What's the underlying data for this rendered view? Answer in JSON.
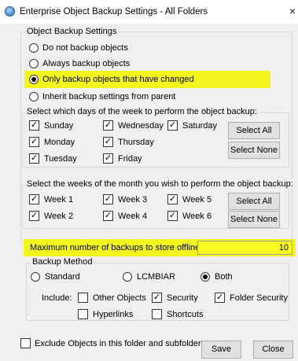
{
  "window": {
    "title": "Enterprise Object Backup Settings - All Folders",
    "close_glyph": "×"
  },
  "object_backup": {
    "group_label": "Object Backup Settings",
    "options": [
      {
        "label": "Do not backup objects",
        "checked": false
      },
      {
        "label": "Always backup objects",
        "checked": false
      },
      {
        "label": "Only backup objects that have changed",
        "checked": true
      },
      {
        "label": "Inherit backup settings from parent",
        "checked": false
      }
    ]
  },
  "days": {
    "group_label": "Select which days of the week to perform the object backup:",
    "items": [
      {
        "label": "Sunday",
        "checked": true
      },
      {
        "label": "Monday",
        "checked": true
      },
      {
        "label": "Tuesday",
        "checked": true
      },
      {
        "label": "Wednesday",
        "checked": true
      },
      {
        "label": "Thursday",
        "checked": true
      },
      {
        "label": "Friday",
        "checked": true
      },
      {
        "label": "Saturday",
        "checked": true
      }
    ],
    "select_all": "Select All",
    "select_none": "Select None"
  },
  "weeks": {
    "group_label": "Select the weeks of the month you wish to perform the object backup:",
    "items": [
      {
        "label": "Week 1",
        "checked": true
      },
      {
        "label": "Week 2",
        "checked": true
      },
      {
        "label": "Week 3",
        "checked": true
      },
      {
        "label": "Week 4",
        "checked": true
      },
      {
        "label": "Week 5",
        "checked": true
      },
      {
        "label": "Week 6",
        "checked": true
      }
    ],
    "select_all": "Select All",
    "select_none": "Select None"
  },
  "max_backups": {
    "label": "Maximum number of backups to store offline:",
    "value": "10"
  },
  "backup_method": {
    "group_label": "Backup Method",
    "options": [
      {
        "label": "Standard",
        "checked": false
      },
      {
        "label": "LCMBIAR",
        "checked": false
      },
      {
        "label": "Both",
        "checked": true
      }
    ],
    "include_label": "Include:",
    "includes": [
      {
        "label": "Other Objects",
        "checked": false
      },
      {
        "label": "Security",
        "checked": true
      },
      {
        "label": "Folder Security",
        "checked": true
      },
      {
        "label": "Hyperlinks",
        "checked": false
      },
      {
        "label": "Shortcuts",
        "checked": false
      }
    ]
  },
  "footer": {
    "exclude_label": "Exclude Objects in this folder and subfolders",
    "exclude_checked": false,
    "save": "Save",
    "close": "Close"
  },
  "colors": {
    "highlight": "#f4f41e",
    "dialog_bg": "#f0f0f0"
  }
}
